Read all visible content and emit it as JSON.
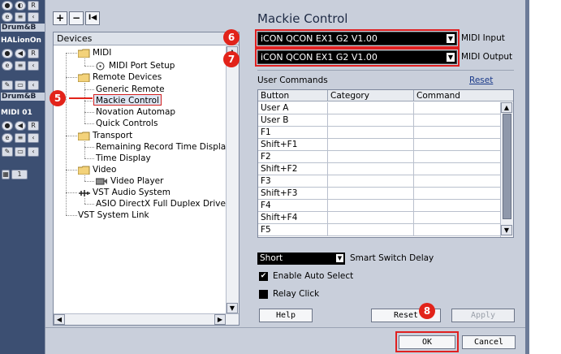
{
  "daw_strip": {
    "labels": [
      "Drum&B",
      "HALionOn",
      "Drum&B",
      "MIDI 01"
    ],
    "track_number": "1"
  },
  "devices": {
    "header": "Devices",
    "toolbar": {
      "add": "+",
      "remove": "−",
      "first": "I◀"
    },
    "tree": {
      "midi": "MIDI",
      "midi_port_setup": "MIDI Port Setup",
      "remote_devices": "Remote Devices",
      "generic_remote": "Generic Remote",
      "mackie_control": "Mackie Control",
      "novation_automap": "Novation Automap",
      "quick_controls": "Quick Controls",
      "transport": "Transport",
      "remaining_record_time": "Remaining Record Time Display",
      "time_display": "Time Display",
      "video": "Video",
      "video_player": "Video Player",
      "vst_audio_system": "VST Audio System",
      "asio_driver": "ASIO DirectX Full Duplex Driver",
      "vst_system_link": "VST System Link"
    }
  },
  "panel": {
    "title": "Mackie Control",
    "midi_input_value": "iCON QCON EX1 G2 V1.00",
    "midi_input_label": "MIDI Input",
    "midi_output_value": "iCON QCON EX1 G2 V1.00",
    "midi_output_label": "MIDI Output",
    "user_commands_label": "User Commands",
    "reset_link": "Reset",
    "table": {
      "columns": [
        "Button",
        "Category",
        "Command"
      ],
      "rows": [
        "User A",
        "User B",
        "F1",
        "Shift+F1",
        "F2",
        "Shift+F2",
        "F3",
        "Shift+F3",
        "F4",
        "Shift+F4",
        "F5"
      ]
    },
    "smart_switch_value": "Short",
    "smart_switch_label": "Smart Switch Delay",
    "enable_auto_select": "Enable Auto Select",
    "relay_click": "Relay Click"
  },
  "buttons": {
    "help": "Help",
    "reset": "Reset",
    "apply": "Apply",
    "ok": "OK",
    "cancel": "Cancel"
  },
  "callouts": [
    "5",
    "6",
    "7",
    "8"
  ],
  "colors": {
    "callout_red": "#e2231a",
    "dialog_bg": "#c9cfdb",
    "strip_blue": "#3c4f72"
  }
}
